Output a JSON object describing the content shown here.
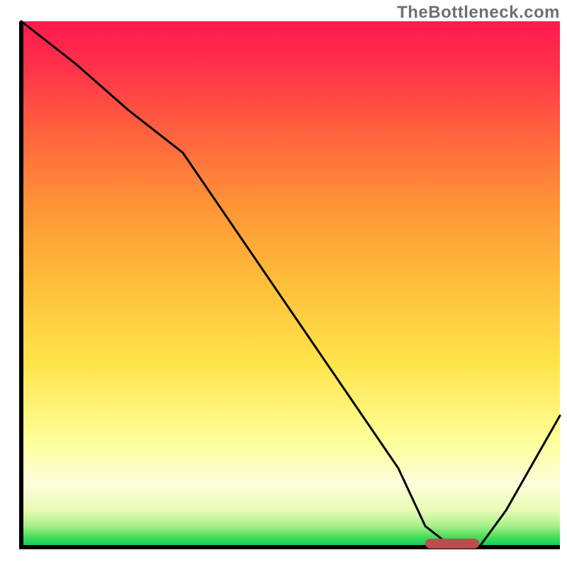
{
  "watermark": "TheBottleneck.com",
  "chart_data": {
    "type": "line",
    "title": "",
    "xlabel": "",
    "ylabel": "",
    "xlim": [
      0,
      100
    ],
    "ylim": [
      0,
      100
    ],
    "grid": false,
    "legend": false,
    "series": [
      {
        "name": "curve",
        "x": [
          0,
          10,
          20,
          30,
          40,
          50,
          60,
          70,
          75,
          80,
          85,
          90,
          100
        ],
        "y": [
          100,
          92,
          83,
          75,
          60,
          45,
          30,
          15,
          4,
          0,
          0,
          7,
          25
        ]
      }
    ],
    "marker": {
      "name": "bottleneck-marker",
      "x_range": [
        75,
        85
      ],
      "y": 0,
      "color": "#bb4e4b"
    },
    "background_gradient": {
      "stops": [
        {
          "offset": 0.0,
          "color": "#00cf5a"
        },
        {
          "offset": 0.02,
          "color": "#4bdd5a"
        },
        {
          "offset": 0.04,
          "color": "#a6ef8a"
        },
        {
          "offset": 0.07,
          "color": "#e9fbb4"
        },
        {
          "offset": 0.12,
          "color": "#fdfddc"
        },
        {
          "offset": 0.2,
          "color": "#feff9a"
        },
        {
          "offset": 0.35,
          "color": "#ffe44a"
        },
        {
          "offset": 0.5,
          "color": "#ffbf3a"
        },
        {
          "offset": 0.65,
          "color": "#ff9436"
        },
        {
          "offset": 0.8,
          "color": "#ff5e3f"
        },
        {
          "offset": 0.92,
          "color": "#ff2f4a"
        },
        {
          "offset": 1.0,
          "color": "#ff1a4f"
        }
      ]
    },
    "axis_stroke_width": 6,
    "curve_stroke_width": 3
  }
}
